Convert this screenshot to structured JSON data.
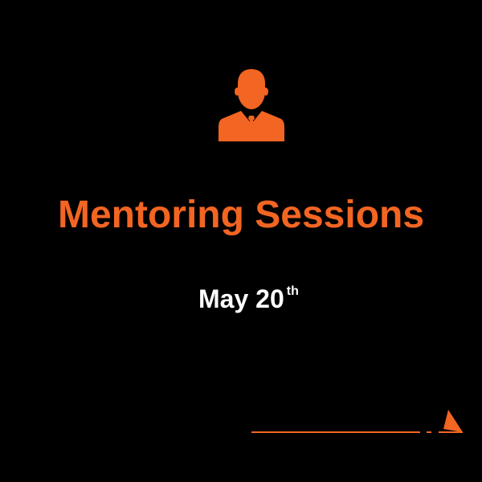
{
  "headline": {
    "title": "Mentoring Sessions",
    "date_main": "May 20",
    "date_suffix": "th"
  },
  "icons": {
    "person": "businessman-icon",
    "footer_mark": "arrow-mark-icon"
  },
  "colors": {
    "background": "#000000",
    "accent": "#f26522",
    "text": "#ffffff"
  }
}
